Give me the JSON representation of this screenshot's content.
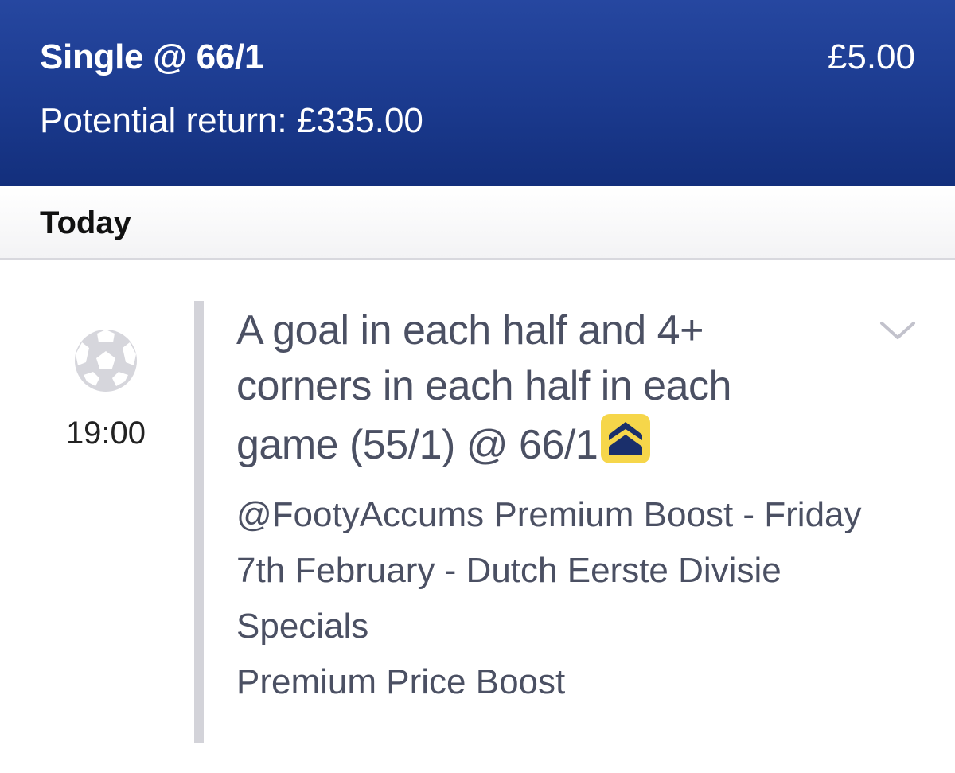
{
  "header": {
    "bet_type": "Single @ 66/1",
    "stake": "£5.00",
    "potential_return": "Potential return: £335.00",
    "background_color": "#1b3a8e"
  },
  "day_section": {
    "label": "Today"
  },
  "event": {
    "sport_icon": "football-icon",
    "time": "19:00",
    "selection": "A goal in each half and 4+ corners in each half in each game (55/1) @ 66/1",
    "boost_icon": "price-boost-icon",
    "boost_color": "#f6d64a",
    "market": "@FootyAccums Premium Boost - Friday 7th February - Dutch Eerste Divisie Specials",
    "boost_type": "Premium Price Boost",
    "expand_icon": "chevron-down-icon"
  }
}
